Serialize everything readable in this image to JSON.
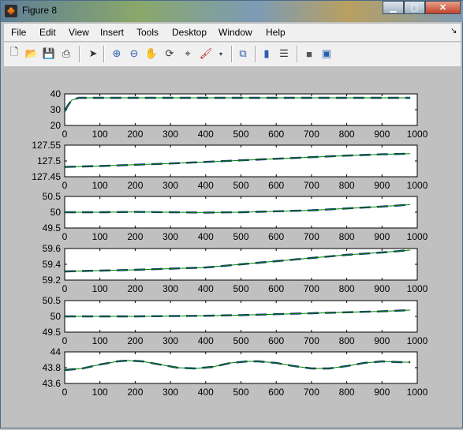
{
  "window": {
    "title": "Figure 8"
  },
  "menu": [
    "File",
    "Edit",
    "View",
    "Insert",
    "Tools",
    "Desktop",
    "Window",
    "Help"
  ],
  "toolbar_icons": [
    "new-figure-icon",
    "open-file-icon",
    "save-icon",
    "print-icon",
    "pointer-icon",
    "zoom-in-icon",
    "zoom-out-icon",
    "pan-icon",
    "rotate-3d-icon",
    "data-cursor-icon",
    "brush-icon",
    "link-plot-icon",
    "colorbar-icon",
    "legend-icon",
    "hide-plot-tools-icon",
    "show-plot-tools-icon"
  ],
  "colors": {
    "line_green": "#008000",
    "line_blue": "#0d2b7a",
    "axes_bg": "#ffffff"
  },
  "chart_data": [
    {
      "type": "line",
      "xlim": [
        0,
        1000
      ],
      "ylim": [
        20,
        40
      ],
      "yticks": [
        "40",
        "30",
        "20"
      ],
      "xticks": [
        "0",
        "100",
        "200",
        "300",
        "400",
        "500",
        "600",
        "700",
        "800",
        "900",
        "1000"
      ],
      "series": [
        {
          "color": "green",
          "x": [
            0,
            5,
            10,
            20,
            40,
            100,
            300,
            500,
            700,
            900,
            980
          ],
          "y": [
            29,
            31,
            33,
            36,
            37.5,
            37.5,
            37.5,
            37.5,
            37.5,
            37.5,
            37.5
          ]
        }
      ]
    },
    {
      "type": "line",
      "xlim": [
        0,
        1000
      ],
      "ylim": [
        127.45,
        127.55
      ],
      "yticks": [
        "127.55",
        "127.5",
        "127.45"
      ],
      "xticks": [
        "0",
        "100",
        "200",
        "300",
        "400",
        "500",
        "600",
        "700",
        "800",
        "900",
        "1000"
      ],
      "series": [
        {
          "color": "green",
          "x": [
            0,
            100,
            200,
            300,
            400,
            500,
            600,
            700,
            800,
            900,
            980
          ],
          "y": [
            127.481,
            127.484,
            127.488,
            127.492,
            127.497,
            127.502,
            127.507,
            127.512,
            127.517,
            127.521,
            127.523
          ]
        }
      ]
    },
    {
      "type": "line",
      "xlim": [
        0,
        1000
      ],
      "ylim": [
        49.5,
        50.5
      ],
      "yticks": [
        "50.5",
        "50",
        "49.5"
      ],
      "xticks": [
        "0",
        "100",
        "200",
        "300",
        "400",
        "500",
        "600",
        "700",
        "800",
        "900",
        "1000"
      ],
      "series": [
        {
          "color": "green",
          "x": [
            0,
            100,
            200,
            300,
            400,
            500,
            600,
            700,
            800,
            900,
            980
          ],
          "y": [
            50.0,
            50.0,
            50.01,
            50.0,
            49.99,
            50.0,
            50.03,
            50.06,
            50.12,
            50.18,
            50.24
          ]
        }
      ]
    },
    {
      "type": "line",
      "xlim": [
        0,
        1000
      ],
      "ylim": [
        59.2,
        59.6
      ],
      "yticks": [
        "59.6",
        "59.4",
        "59.2"
      ],
      "xticks": [
        "0",
        "100",
        "200",
        "300",
        "400",
        "500",
        "600",
        "700",
        "800",
        "900",
        "1000"
      ],
      "series": [
        {
          "color": "green",
          "x": [
            0,
            100,
            200,
            300,
            400,
            500,
            600,
            700,
            800,
            900,
            980
          ],
          "y": [
            59.31,
            59.32,
            59.33,
            59.345,
            59.36,
            59.4,
            59.44,
            59.48,
            59.52,
            59.55,
            59.58
          ]
        }
      ]
    },
    {
      "type": "line",
      "xlim": [
        0,
        1000
      ],
      "ylim": [
        49.5,
        50.5
      ],
      "yticks": [
        "50.5",
        "50",
        "49.5"
      ],
      "xticks": [
        "0",
        "100",
        "200",
        "300",
        "400",
        "500",
        "600",
        "700",
        "800",
        "900",
        "1000"
      ],
      "series": [
        {
          "color": "green",
          "x": [
            0,
            100,
            200,
            300,
            400,
            500,
            600,
            700,
            800,
            900,
            980
          ],
          "y": [
            50.0,
            50.0,
            50.0,
            50.01,
            50.02,
            50.04,
            50.07,
            50.1,
            50.13,
            50.16,
            50.2
          ]
        }
      ]
    },
    {
      "type": "line",
      "xlim": [
        0,
        1000
      ],
      "ylim": [
        43.6,
        44
      ],
      "yticks": [
        "44",
        "43.8",
        "43.6"
      ],
      "xticks": [
        "0",
        "100",
        "200",
        "300",
        "400",
        "500",
        "600",
        "700",
        "800",
        "900",
        "1000"
      ],
      "series": [
        {
          "color": "green",
          "x": [
            0,
            50,
            100,
            150,
            180,
            220,
            270,
            320,
            370,
            420,
            470,
            520,
            550,
            600,
            650,
            700,
            750,
            800,
            850,
            900,
            950,
            980
          ],
          "y": [
            43.77,
            43.79,
            43.84,
            43.88,
            43.89,
            43.88,
            43.84,
            43.8,
            43.79,
            43.81,
            43.86,
            43.88,
            43.88,
            43.86,
            43.82,
            43.79,
            43.79,
            43.82,
            43.86,
            43.88,
            43.87,
            43.87
          ]
        }
      ]
    }
  ]
}
